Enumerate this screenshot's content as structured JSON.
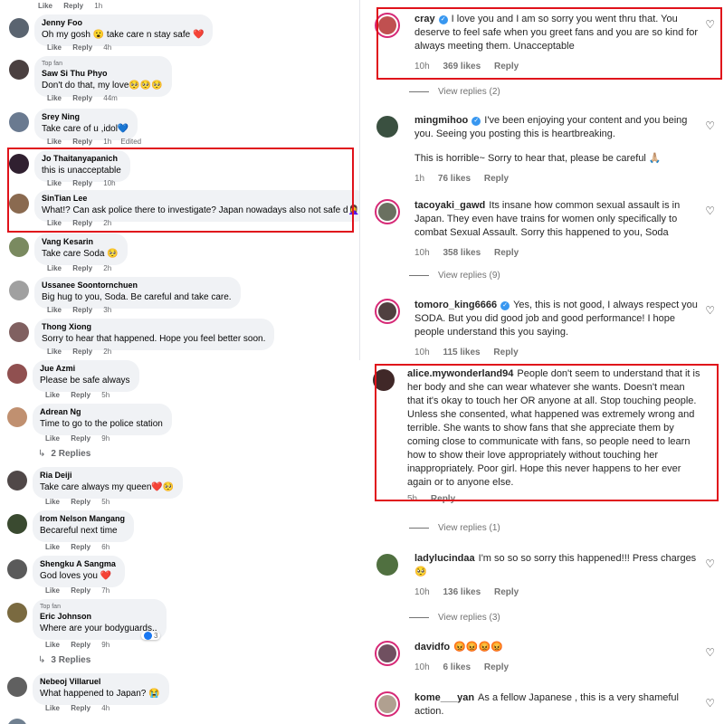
{
  "fb_top": {
    "top_actions": {
      "like": "Like",
      "reply": "Reply",
      "time": "1h"
    },
    "comments": [
      {
        "name": "Jenny Foo",
        "text": "Oh my gosh 😮 take care n stay safe ❤️",
        "like": "Like",
        "reply": "Reply",
        "time": "4h",
        "avatar_color": "#5a6470"
      },
      {
        "name": "Saw Si Thu Phyo",
        "badge": "Top fan",
        "text": "Don't do that, my love🥺🥺🥺",
        "like": "Like",
        "reply": "Reply",
        "time": "44m",
        "avatar_color": "#4a4040"
      },
      {
        "name": "Srey Ning",
        "text": "Take care of u ,idol💙",
        "like": "Like",
        "reply": "Reply",
        "time": "1h",
        "edited": "Edited",
        "avatar_color": "#6a7a90"
      },
      {
        "name": "Jo Thaitanyapanich",
        "text": "this is unacceptable",
        "like": "Like",
        "reply": "Reply",
        "time": "10h",
        "avatar_color": "#302030"
      },
      {
        "name": "SinTian Lee",
        "text": "What!? Can ask police there to investigate? Japan nowadays also not safe d🤦‍♀️",
        "like": "Like",
        "reply": "Reply",
        "time": "2h",
        "avatar_color": "#8a6a50"
      },
      {
        "name": "Vang Kesarin",
        "text": "Take care Soda 🥺",
        "like": "Like",
        "reply": "Reply",
        "time": "2h",
        "avatar_color": "#7a8a60"
      },
      {
        "name": "Ussanee Soontornchuen",
        "text": "Big hug to you, Soda. Be careful and take care.",
        "like": "Like",
        "reply": "Reply",
        "time": "3h",
        "avatar_color": "#a0a0a0"
      },
      {
        "name": "Thong Xiong",
        "text": "Sorry to hear that happened. Hope you feel better soon.",
        "like": "Like",
        "reply": "Reply",
        "time": "2h",
        "avatar_color": "#806060"
      }
    ]
  },
  "fb_bottom": {
    "comments": [
      {
        "name": "Jue Azmi",
        "text": "Please be safe always",
        "like": "Like",
        "reply": "Reply",
        "time": "5h",
        "avatar_color": "#905050"
      },
      {
        "name": "Adrean Ng",
        "text": "Time to go to the police station",
        "like": "Like",
        "reply": "Reply",
        "time": "9h",
        "replies": "2 Replies",
        "avatar_color": "#c09070"
      },
      {
        "name": "Ria Deiji",
        "text": "Take care always my queen❤️🥺",
        "like": "Like",
        "reply": "Reply",
        "time": "5h",
        "avatar_color": "#504848"
      },
      {
        "name": "Irom Nelson Mangang",
        "text": "Becareful next time",
        "like": "Like",
        "reply": "Reply",
        "time": "6h",
        "avatar_color": "#3a4a30"
      },
      {
        "name": "Shengku A Sangma",
        "text": "God loves you ❤️",
        "like": "Like",
        "reply": "Reply",
        "time": "7h",
        "avatar_color": "#5a5a5a"
      },
      {
        "name": "Eric Johnson",
        "badge": "Top fan",
        "text": "Where are your bodyguards..",
        "like": "Like",
        "reply": "Reply",
        "time": "9h",
        "reactions": "3",
        "replies": "3 Replies",
        "avatar_color": "#7a6a40"
      },
      {
        "name": "Nebeoj Villaruel",
        "text": "What happened to Japan? 😭",
        "like": "Like",
        "reply": "Reply",
        "time": "4h",
        "avatar_color": "#606060"
      }
    ],
    "bottom_actions": {
      "like": "Like",
      "reply": "Reply",
      "time": "4h"
    }
  },
  "ig_top": {
    "comments": [
      {
        "user": "cray",
        "verified": true,
        "text": "I love you and I am so sorry you went thru that. You deserve to feel safe when you greet fans and you are so kind for always meeting them. Unacceptable",
        "time": "10h",
        "likes": "369 likes",
        "reply": "Reply",
        "view_replies": "View replies (2)",
        "avatar_color": "#c05050"
      },
      {
        "user": "mingmihoo",
        "verified": true,
        "text": "I've been enjoying your content and you being you. Seeing you posting this is heartbreaking.",
        "text2": "This is horrible~ Sorry to hear that, please be careful 🙏🏼",
        "time": "1h",
        "likes": "76 likes",
        "reply": "Reply",
        "avatar_color": "#3a5040"
      },
      {
        "user": "tacoyaki_gawd",
        "verified": false,
        "text": "Its insane how common sexual assault is in Japan. They even have trains for women only specifically to combat Sexual Assault. Sorry this happened to you, Soda",
        "time": "10h",
        "likes": "358 likes",
        "reply": "Reply",
        "view_replies": "View replies (9)",
        "avatar_color": "#6a7060"
      },
      {
        "user": "tomoro_king6666",
        "verified": true,
        "text": "Yes, this is not good, I always respect you SODA. But you did good job and good performance! I hope people understand this you saying.",
        "time": "10h",
        "likes": "115 likes",
        "reply": "Reply",
        "avatar_color": "#504040"
      }
    ]
  },
  "ig_bottom": {
    "comments": [
      {
        "user": "alice.mywonderland94",
        "verified": false,
        "text": "People don't seem to understand that it is her body and she can wear whatever she wants. Doesn't mean that it's okay to touch her OR anyone at all. Stop touching people. Unless she consented, what happened was extremely wrong and terrible. She wants to show fans that she appreciate them by coming close to communicate with fans, so people need to learn how to show their love appropriately without touching her inappropriately. Poor girl. Hope this never happens to her ever again or to anyone else.",
        "time": "5h",
        "likes": "",
        "reply": "Reply",
        "view_replies": "View replies (1)",
        "avatar_color": "#402828"
      },
      {
        "user": "ladylucindaa",
        "verified": false,
        "text": "I'm so so so sorry this happened!!! Press charges 🥺",
        "time": "10h",
        "likes": "136 likes",
        "reply": "Reply",
        "view_replies": "View replies (3)",
        "avatar_color": "#507040"
      },
      {
        "user": "davidfo",
        "verified": false,
        "text": "😡😡😡😡",
        "time": "10h",
        "likes": "6 likes",
        "reply": "Reply",
        "avatar_color": "#705060"
      },
      {
        "user": "kome___yan",
        "verified": false,
        "text": "As a fellow Japanese , this is a very shameful action.",
        "avatar_color": "#b0a090"
      }
    ]
  },
  "icons": {
    "heart": "heart-icon",
    "verified": "verified-badge-icon",
    "reply_arrow": "reply-arrow-icon"
  },
  "colors": {
    "highlight": "#e0121b",
    "fb_bubble": "#f0f2f5",
    "ig_verified": "#3897f0"
  }
}
